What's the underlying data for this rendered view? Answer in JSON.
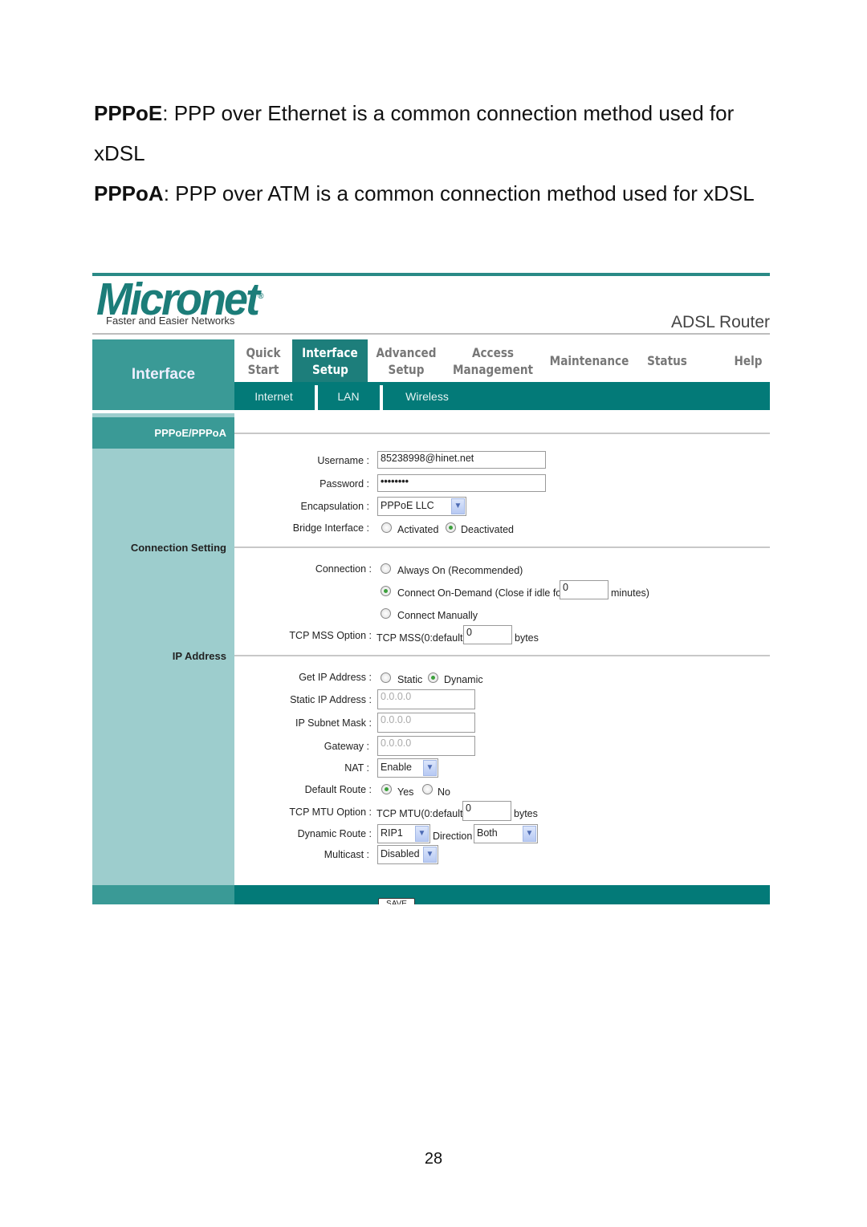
{
  "document": {
    "paragraphs": [
      {
        "term": "PPPoE",
        "text": ": PPP over Ethernet is a common connection method used for",
        "continuation": "xDSL"
      },
      {
        "term": "PPPoA",
        "text": ": PPP over ATM is a common connection method used for xDSL"
      }
    ],
    "page_number": "28"
  },
  "router": {
    "brand": "Micronet",
    "tagline": "Faster and Easier Networks",
    "product": "ADSL Router",
    "section_title": "Interface",
    "nav": [
      {
        "line1": "Quick",
        "line2": "Start"
      },
      {
        "line1": "Interface",
        "line2": "Setup",
        "active": true
      },
      {
        "line1": "Advanced",
        "line2": "Setup"
      },
      {
        "line1": "Access",
        "line2": "Management"
      },
      {
        "line1": "Maintenance",
        "line2": ""
      },
      {
        "line1": "Status",
        "line2": ""
      },
      {
        "line1": "Help",
        "line2": ""
      }
    ],
    "subnav": [
      "Internet",
      "LAN",
      "Wireless"
    ],
    "sidebar": {
      "section": "PPPoE/PPPoA",
      "connection_setting": "Connection Setting",
      "ip_address": "IP Address"
    },
    "form": {
      "username_label": "Username :",
      "username_value": "85238998@hinet.net",
      "password_label": "Password :",
      "password_value": "••••••••",
      "encapsulation_label": "Encapsulation :",
      "encapsulation_value": "PPPoE LLC",
      "bridge_label": "Bridge Interface :",
      "bridge_activated": "Activated",
      "bridge_deactivated": "Deactivated",
      "bridge_selected": "Deactivated",
      "connection_label": "Connection :",
      "conn_always": "Always On (Recommended)",
      "conn_demand": "Connect On-Demand (Close if idle for",
      "conn_demand_value": "0",
      "conn_demand_unit": "minutes)",
      "conn_manual": "Connect Manually",
      "conn_selected": "Connect On-Demand",
      "mss_label": "TCP MSS Option :",
      "mss_text": "TCP MSS(0:default)",
      "mss_value": "0",
      "mss_unit": "bytes",
      "getip_label": "Get IP Address :",
      "getip_static": "Static",
      "getip_dynamic": "Dynamic",
      "getip_selected": "Dynamic",
      "static_ip_label": "Static IP Address :",
      "static_ip_value": "0.0.0.0",
      "subnet_label": "IP Subnet Mask :",
      "subnet_value": "0.0.0.0",
      "gateway_label": "Gateway :",
      "gateway_value": "0.0.0.0",
      "nat_label": "NAT :",
      "nat_value": "Enable",
      "default_route_label": "Default Route :",
      "default_route_yes": "Yes",
      "default_route_no": "No",
      "default_route_selected": "Yes",
      "mtu_label": "TCP MTU Option :",
      "mtu_text": "TCP MTU(0:default)",
      "mtu_value": "0",
      "mtu_unit": "bytes",
      "dynroute_label": "Dynamic Route :",
      "dynroute_value": "RIP1",
      "direction_label": "Direction",
      "direction_value": "Both",
      "multicast_label": "Multicast :",
      "multicast_value": "Disabled",
      "save_label": "SAVE"
    },
    "colors": {
      "brand_teal": "#1c7d79",
      "nav_active": "#1d7e7b",
      "subnav": "#037a78",
      "sidebar": "#9dcdcd",
      "sidebar_header": "#3a9a96"
    }
  }
}
